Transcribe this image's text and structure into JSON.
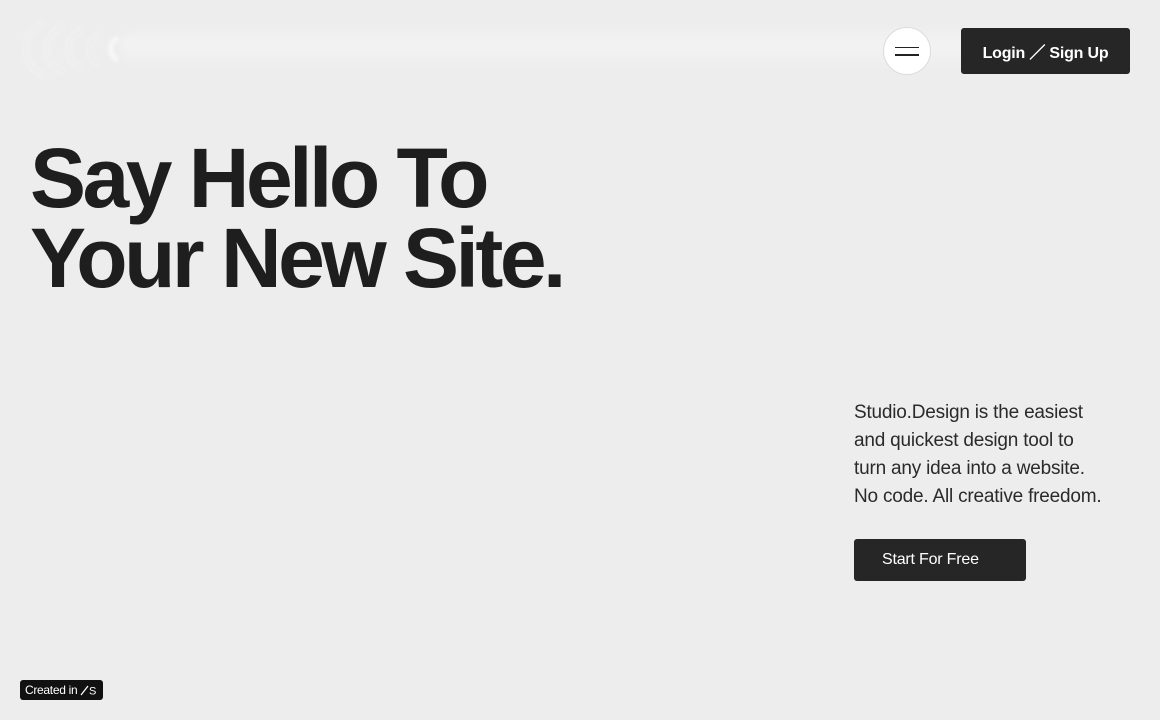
{
  "header": {
    "logo_icon": "studio-logo-icon",
    "menu_icon": "hamburger-menu-icon",
    "login_label": "Login ／ Sign Up"
  },
  "hero": {
    "title_lines": [
      "Say Hello To",
      "Your New Site."
    ],
    "description_lines": [
      "Studio.Design is the easiest",
      "and quickest design tool to",
      "turn any idea into a website.",
      "No code. All creative freedom."
    ],
    "cta_label": "Start For Free"
  },
  "badge": {
    "label": "Created in",
    "icon": "studio-s-icon",
    "icon_text": "S"
  },
  "colors": {
    "background": "#ededed",
    "button": "#262626",
    "text": "#1e1e1e",
    "button_text": "#ffffff"
  }
}
